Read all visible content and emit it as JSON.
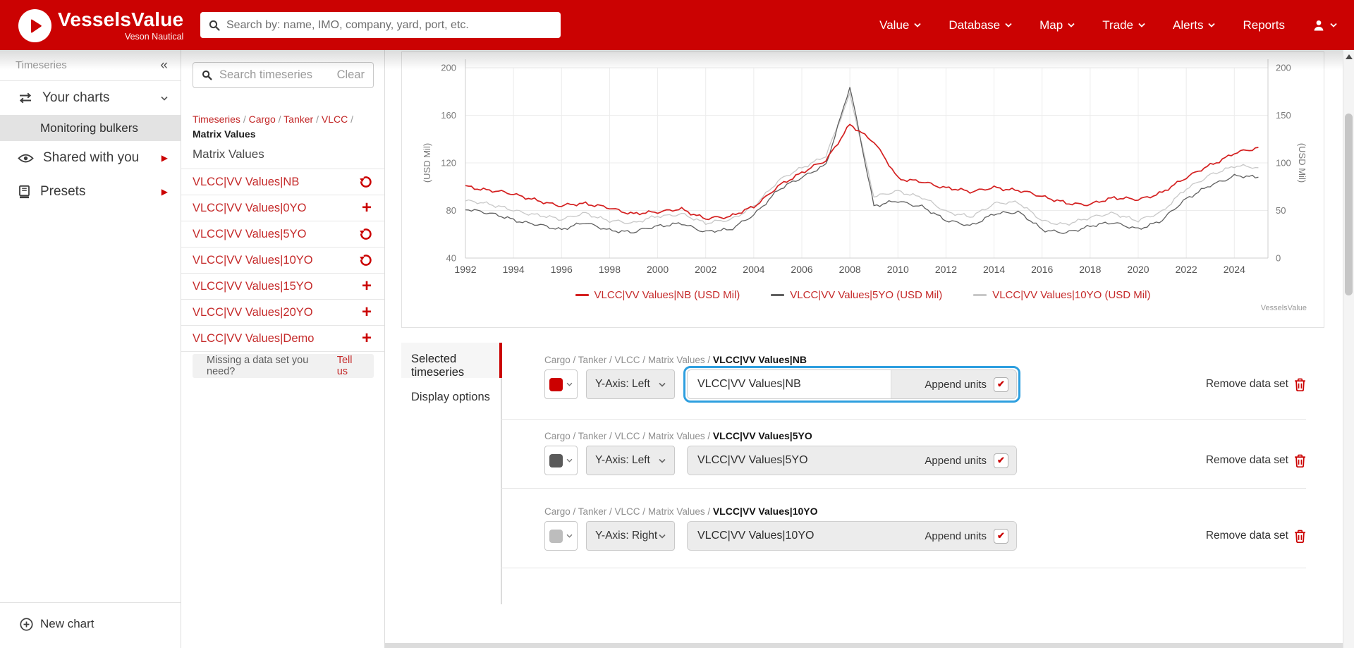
{
  "navbar": {
    "logo_title": "VesselsValue",
    "logo_subtitle": "Veson Nautical",
    "search_placeholder": "Search by: name, IMO, company, yard, port, etc.",
    "items": [
      {
        "label": "Value",
        "caret": true
      },
      {
        "label": "Database",
        "caret": true
      },
      {
        "label": "Map",
        "caret": true
      },
      {
        "label": "Trade",
        "caret": true
      },
      {
        "label": "Alerts",
        "caret": true
      },
      {
        "label": "Reports",
        "caret": false
      }
    ]
  },
  "sidebar": {
    "header": "Timeseries",
    "your_charts": "Your charts",
    "selected_chart": "Monitoring bulkers",
    "shared": "Shared with you",
    "presets": "Presets",
    "new_chart": "New chart"
  },
  "browser": {
    "search_placeholder": "Search timeseries",
    "clear": "Clear",
    "breadcrumb_links": [
      "Timeseries",
      "Cargo",
      "Tanker",
      "VLCC"
    ],
    "breadcrumb_separator": " / ",
    "breadcrumb_current": "Matrix Values",
    "section_title": "Matrix Values",
    "items": [
      {
        "label": "VLCC|VV Values|NB",
        "action": "undo"
      },
      {
        "label": "VLCC|VV Values|0YO",
        "action": "add"
      },
      {
        "label": "VLCC|VV Values|5YO",
        "action": "undo"
      },
      {
        "label": "VLCC|VV Values|10YO",
        "action": "undo"
      },
      {
        "label": "VLCC|VV Values|15YO",
        "action": "add"
      },
      {
        "label": "VLCC|VV Values|20YO",
        "action": "add"
      },
      {
        "label": "VLCC|VV Values|Demo",
        "action": "add"
      }
    ],
    "missing_prompt": "Missing a data set you need?",
    "missing_link": "Tell us"
  },
  "chart_data": {
    "type": "line",
    "grid": true,
    "legend_position": "bottom",
    "watermark": "VesselsValue",
    "x_years": [
      1992,
      1993,
      1994,
      1995,
      1996,
      1997,
      1998,
      1999,
      2000,
      2001,
      2002,
      2003,
      2004,
      2005,
      2006,
      2007,
      2008,
      2009,
      2010,
      2011,
      2012,
      2013,
      2014,
      2015,
      2016,
      2017,
      2018,
      2019,
      2020,
      2021,
      2022,
      2023,
      2024,
      2025
    ],
    "x_ticks": [
      1992,
      1994,
      1996,
      1998,
      2000,
      2002,
      2004,
      2006,
      2008,
      2010,
      2012,
      2014,
      2016,
      2018,
      2020,
      2022,
      2024
    ],
    "left_axis": {
      "label": "(USD Mil)",
      "min": 40,
      "max": 200,
      "ticks": [
        200,
        160,
        120,
        80,
        40
      ]
    },
    "right_axis": {
      "label": "(USD Mil)",
      "min": 0,
      "max": 200,
      "ticks": [
        200,
        150,
        100,
        50,
        0
      ]
    },
    "series": [
      {
        "name": "VLCC|VV Values|NB (USD Mil)",
        "axis": "left",
        "color": "#d42020",
        "values": [
          100,
          97,
          94,
          88,
          84,
          86,
          82,
          77,
          79,
          81,
          73,
          75,
          83,
          100,
          112,
          122,
          152,
          138,
          107,
          104,
          99,
          96,
          99,
          97,
          92,
          86,
          85,
          91,
          89,
          95,
          108,
          118,
          128,
          133
        ]
      },
      {
        "name": "VLCC|VV Values|5YO (USD Mil)",
        "axis": "left",
        "color": "#5f5f5f",
        "values": [
          81,
          78,
          72,
          68,
          64,
          70,
          63,
          62,
          67,
          69,
          62,
          64,
          76,
          97,
          108,
          118,
          184,
          84,
          88,
          83,
          72,
          67,
          77,
          79,
          64,
          61,
          67,
          70,
          64,
          72,
          90,
          101,
          109,
          108
        ]
      },
      {
        "name": "VLCC|VV Values|10YO (USD Mil)",
        "axis": "right",
        "color": "#c8c8c8",
        "values": [
          60,
          57,
          50,
          45,
          41,
          47,
          39,
          37,
          44,
          46,
          37,
          40,
          54,
          81,
          95,
          107,
          172,
          65,
          70,
          64,
          49,
          43,
          57,
          59,
          39,
          35,
          43,
          47,
          39,
          49,
          73,
          87,
          97,
          95
        ]
      }
    ]
  },
  "editor": {
    "tabs": [
      {
        "label": "Selected timeseries",
        "active": true
      },
      {
        "label": "Display options",
        "active": false
      }
    ],
    "append_label": "Append units",
    "remove_label": "Remove data set",
    "rows": [
      {
        "breadcrumb_prefix": "Cargo / Tanker / VLCC / Matrix Values / ",
        "name": "VLCC|VV Values|NB",
        "swatch": "#cc0000",
        "axis_option": "Y-Axis: Left",
        "input_value": "VLCC|VV Values|NB",
        "append_checked": true,
        "highlighted": true
      },
      {
        "breadcrumb_prefix": "Cargo / Tanker / VLCC / Matrix Values / ",
        "name": "VLCC|VV Values|5YO",
        "swatch": "#5a5a5a",
        "axis_option": "Y-Axis: Left",
        "input_value": "VLCC|VV Values|5YO",
        "append_checked": true,
        "highlighted": false
      },
      {
        "breadcrumb_prefix": "Cargo / Tanker / VLCC / Matrix Values / ",
        "name": "VLCC|VV Values|10YO",
        "swatch": "#bdbdbd",
        "axis_option": "Y-Axis: Right",
        "input_value": "VLCC|VV Values|10YO",
        "append_checked": true,
        "highlighted": false
      }
    ]
  },
  "icons": {
    "check": "✔",
    "collapse": "«",
    "submenu": "▶",
    "plus": "+"
  }
}
